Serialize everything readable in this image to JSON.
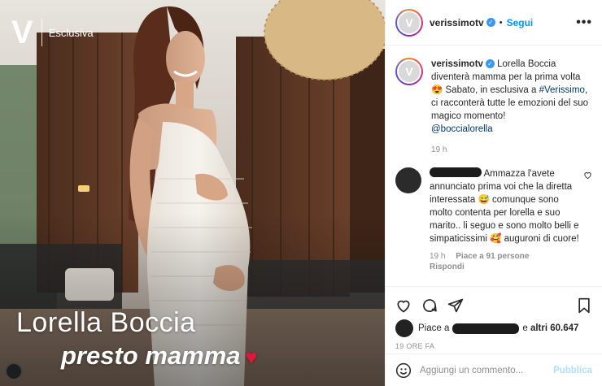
{
  "photo": {
    "brand_letter": "V",
    "brand_tag": "Esclusiva",
    "caption_name": "Lorella Boccia",
    "caption_sub": "presto mamma",
    "caption_heart": "♥",
    "colors": {
      "heart": "#e3163a",
      "dress": "#f3efe9",
      "background_wood": "#5b3624"
    }
  },
  "header": {
    "username": "verissimotv",
    "verified_icon": "✓",
    "separator": "•",
    "follow_label": "Segui",
    "more_icon": "•••"
  },
  "caption": {
    "username": "verissimotv",
    "lines": [
      "Lorella Boccia",
      "diventerà mamma per la prima volta",
      "😍 Sabato, in esclusiva a ",
      "#Verissimo",
      ",",
      "ci racconterà tutte le emozioni del",
      "suo magico momento!",
      "@boccialorella"
    ],
    "time": "19 h"
  },
  "comment": {
    "text_lines": [
      "Ammazza l'avete",
      "annunciato prima voi che la",
      "diretta interessata 😅 comunque",
      "sono molto contenta per lorella e",
      "suo marito.. li seguo e sono",
      "molto belli e simpaticissimi 🥰",
      "auguroni di cuore!"
    ],
    "time": "19 h",
    "likes": "Piace a 91 persone",
    "reply": "Rispondi"
  },
  "actions": {
    "likes_prefix": "Piace a",
    "likes_and": "e",
    "likes_others": "altri 60.647",
    "date": "19 ORE FA"
  },
  "composer": {
    "placeholder": "Aggiungi un commento...",
    "publish_label": "Pubblica"
  },
  "colors": {
    "link": "#0095f6",
    "hashtag": "#00376b",
    "muted": "#8e8e8e",
    "verified": "#3897f0",
    "publish_disabled": "#b2dffc"
  }
}
